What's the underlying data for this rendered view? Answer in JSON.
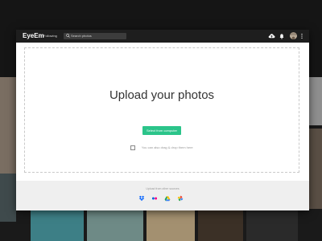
{
  "app": {
    "logo": "EyeEm"
  },
  "topbar": {
    "nav_following": "Following",
    "search_placeholder": "Search photos",
    "icons": [
      "upload-cloud-icon",
      "notification-bell-icon",
      "avatar",
      "more-vertical-icon"
    ]
  },
  "upload": {
    "title": "Upload your photos",
    "select_button": "Select from computer",
    "drag_hint": "You can also drag & drop them here"
  },
  "footer": {
    "label": "Upload from other sources",
    "sources": [
      "dropbox-icon",
      "flickr-icon",
      "google-drive-icon",
      "google-photos-icon"
    ]
  },
  "colors": {
    "accent": "#2bc48a",
    "topbar": "#1e1e1e",
    "footer": "#efefef",
    "dropbox": "#0061ff",
    "flickr_blue": "#0063dc",
    "flickr_pink": "#ff0084"
  }
}
